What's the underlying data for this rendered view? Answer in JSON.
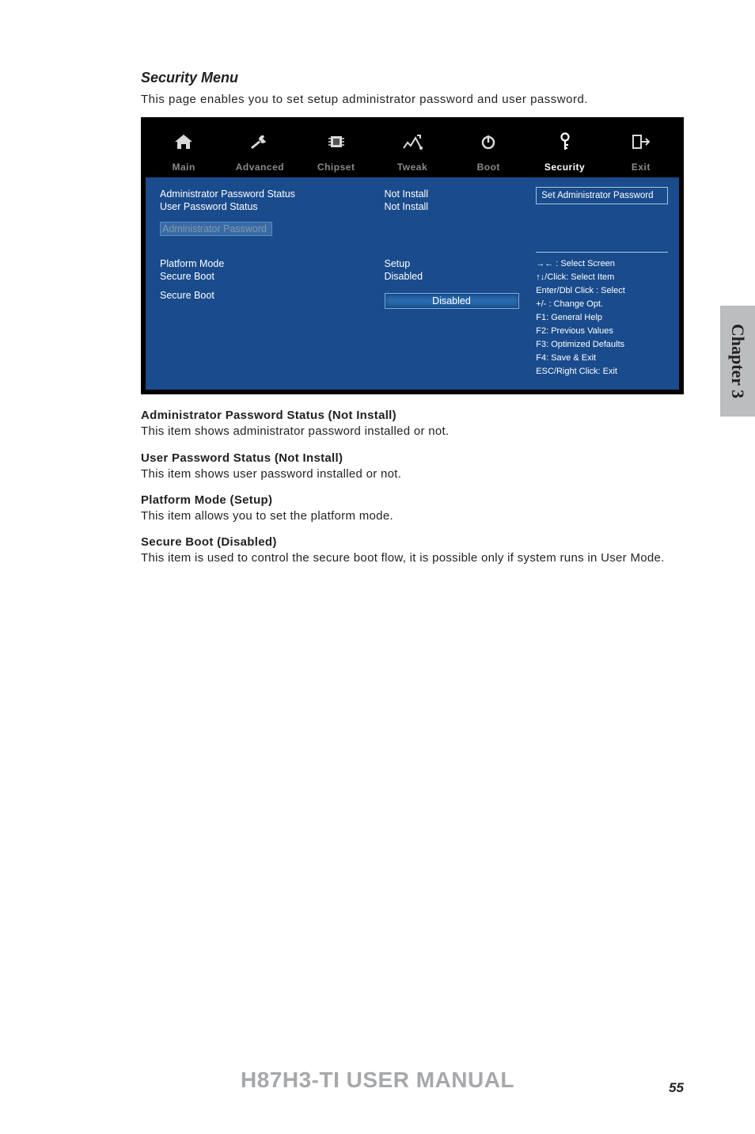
{
  "section_title": "Security Menu",
  "intro": "This page enables you to set setup administrator password and user password.",
  "bios": {
    "tabs": {
      "main": "Main",
      "advanced": "Advanced",
      "chipset": "Chipset",
      "tweak": "Tweak",
      "boot": "Boot",
      "security": "Security",
      "exit": "Exit"
    },
    "rows": {
      "admin_pw_status_label": "Administrator Password Status",
      "admin_pw_status_value": "Not Install",
      "user_pw_status_label": "User Password Status",
      "user_pw_status_value": "Not Install",
      "admin_pw_entry": "Administrator  Password",
      "platform_mode_label": "Platform Mode",
      "platform_mode_value": "Setup",
      "secure_boot_label": "Secure Boot",
      "secure_boot_value": "Disabled",
      "secure_boot_select_label": "Secure Boot",
      "secure_boot_select_value": "Disabled"
    },
    "info_title": "Set Administrator Password",
    "help": {
      "l1": "→←   : Select Screen",
      "l2": "↑↓/Click: Select Item",
      "l3": "Enter/Dbl Click : Select",
      "l4": "+/- : Change Opt.",
      "l5": "F1: General Help",
      "l6": "F2: Previous Values",
      "l7": "F3: Optimized Defaults",
      "l8": "F4: Save & Exit",
      "l9": "ESC/Right Click: Exit"
    }
  },
  "descriptions": {
    "admin_hdr": "Administrator Password Status (Not Install)",
    "admin_body": "This item shows administrator password installed or not.",
    "user_hdr": "User Password Status (Not Install)",
    "user_body": "This item shows user password installed or not.",
    "platform_hdr": "Platform Mode (Setup)",
    "platform_body": "This item allows you to set the platform mode.",
    "secure_hdr": "Secure Boot (Disabled)",
    "secure_body": "This item is used to control the secure boot flow, it is possible only if system runs in User Mode."
  },
  "side_tab": "Chapter 3",
  "footer": "H87H3-TI USER MANUAL",
  "page_number": "55"
}
